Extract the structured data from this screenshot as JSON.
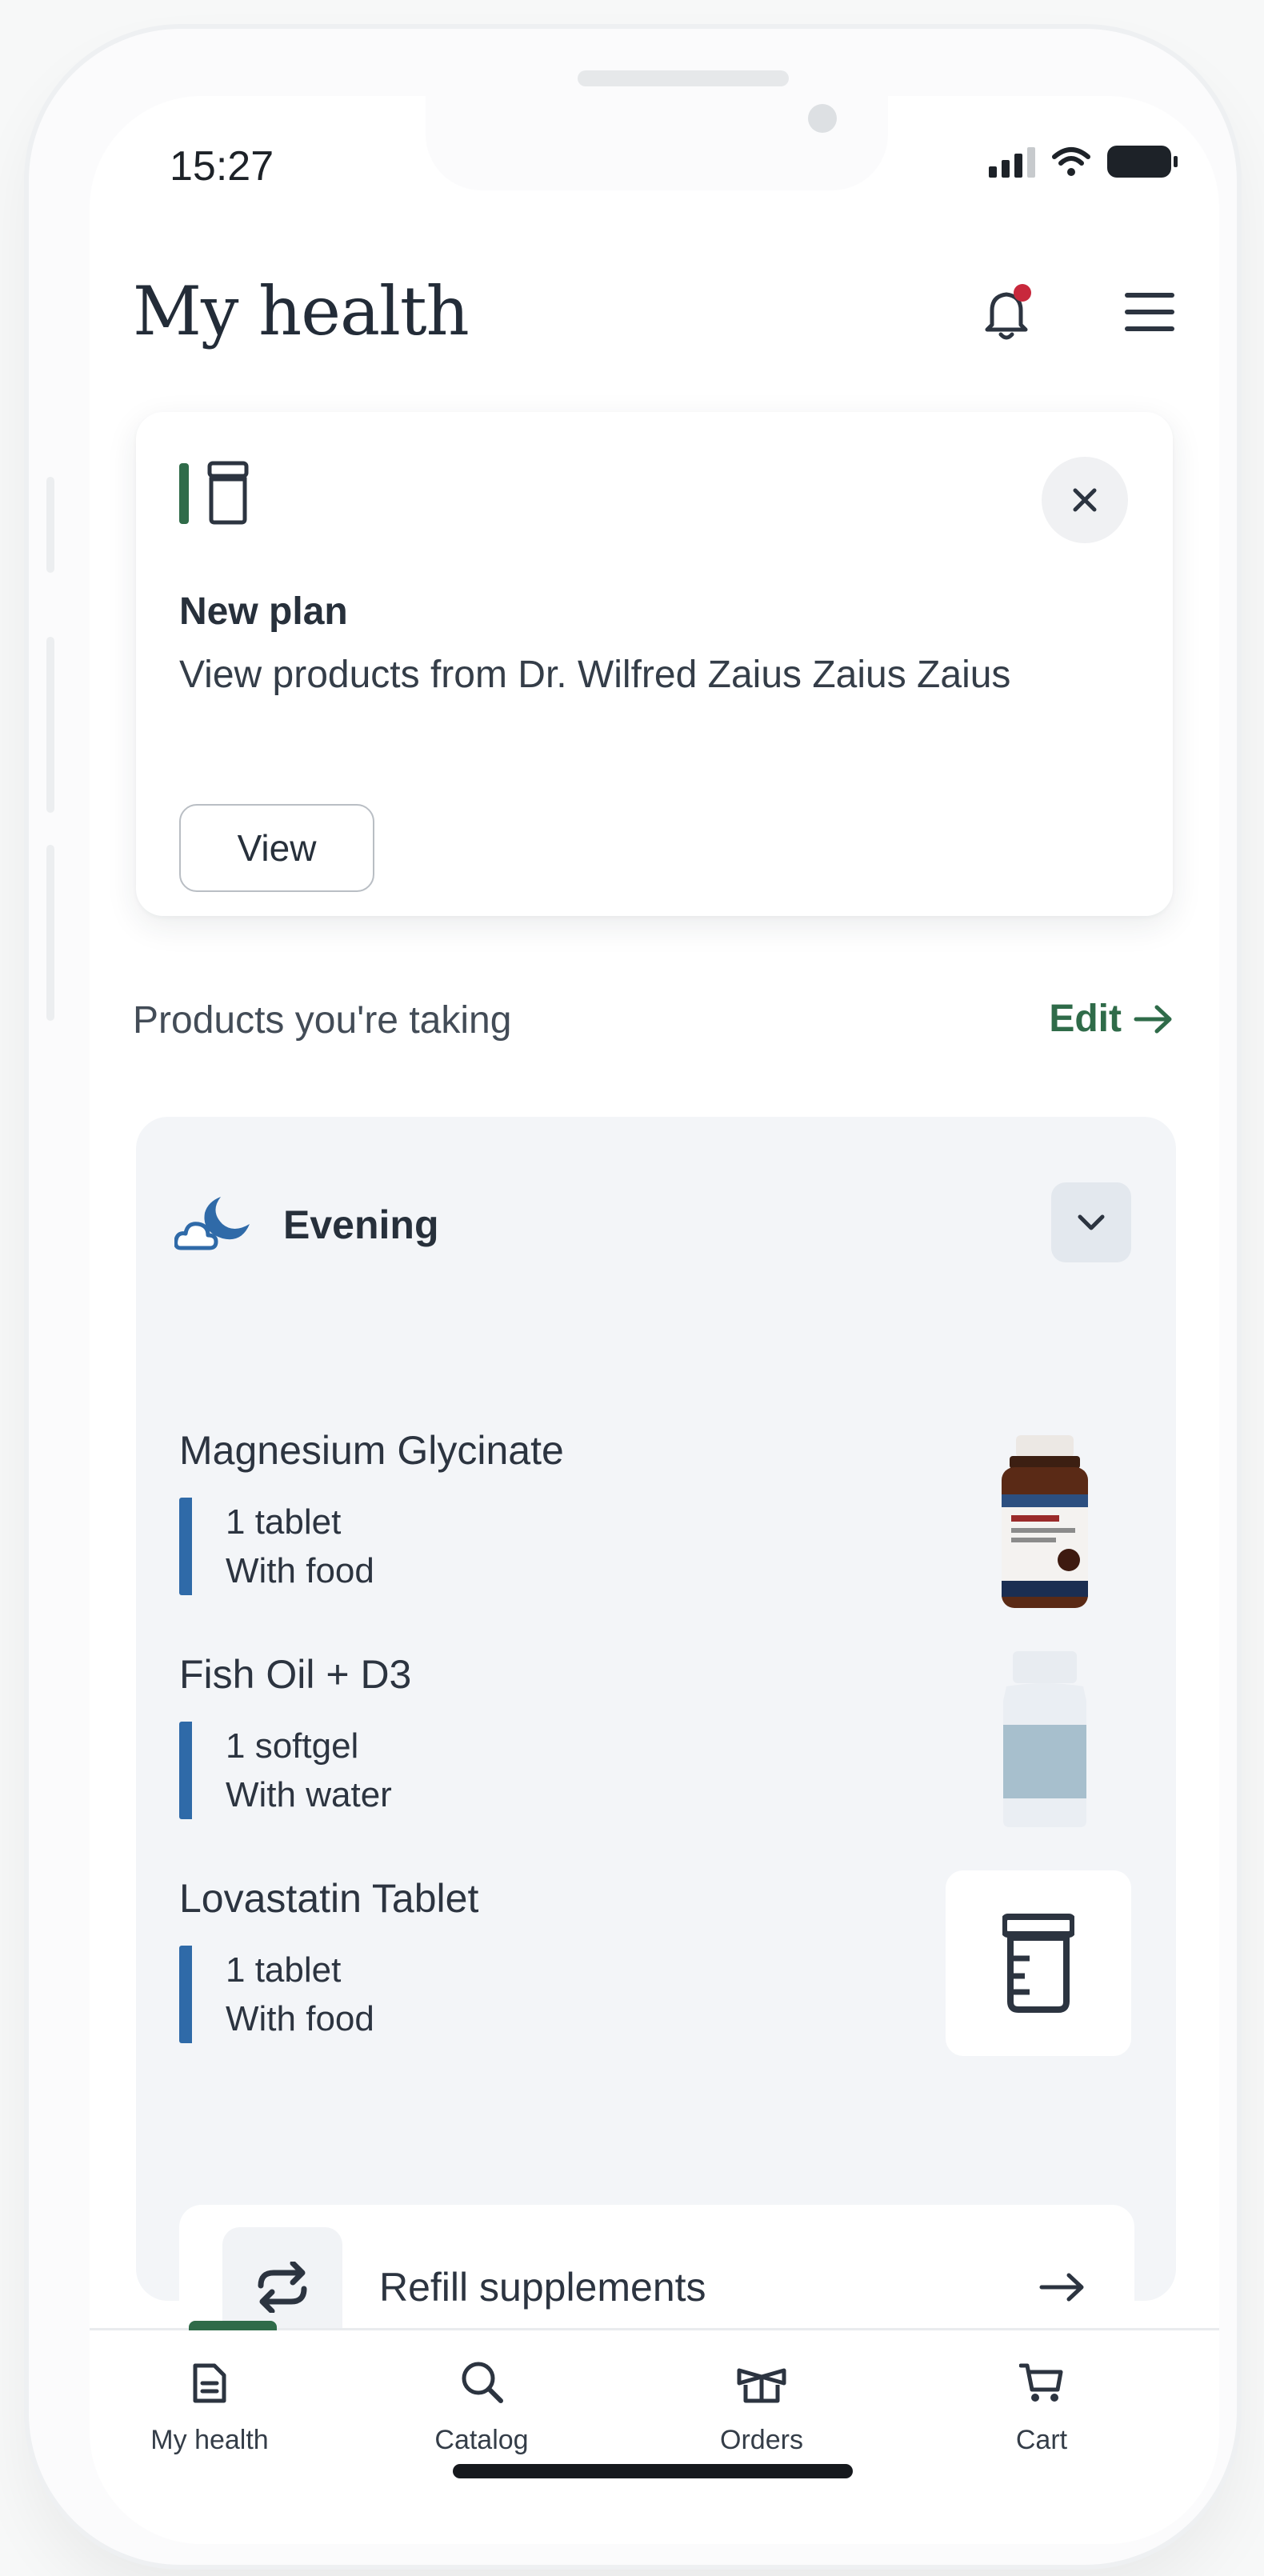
{
  "status_bar": {
    "time": "15:27"
  },
  "header": {
    "title": "My health"
  },
  "plan_card": {
    "title": "New plan",
    "description": "View products from Dr. Wilfred Zaius Zaius Zaius",
    "view_label": "View"
  },
  "products_section": {
    "label": "Products you're taking",
    "edit_label": "Edit",
    "period": "Evening",
    "items": [
      {
        "name": "Magnesium Glycinate",
        "dose": "1 tablet",
        "instruction": "With food",
        "thumb_icon": "supplement-bottle-photo"
      },
      {
        "name": "Fish Oil + D3",
        "dose": "1 softgel",
        "instruction": "With water",
        "thumb_icon": "generic-bottle-icon"
      },
      {
        "name": "Lovastatin Tablet",
        "dose": "1 tablet",
        "instruction": "With food",
        "thumb_icon": "pill-container-icon"
      }
    ],
    "refill_label": "Refill supplements"
  },
  "tabs": [
    {
      "label": "My health",
      "icon": "document-icon",
      "active": true
    },
    {
      "label": "Catalog",
      "icon": "search-icon",
      "active": false
    },
    {
      "label": "Orders",
      "icon": "box-icon",
      "active": false
    },
    {
      "label": "Cart",
      "icon": "cart-icon",
      "active": false
    }
  ],
  "colors": {
    "accent_green": "#2f6b49",
    "dose_bar_blue": "#2f6aa8",
    "notification_red": "#c8283c",
    "panel_bg": "#f3f5f8"
  }
}
